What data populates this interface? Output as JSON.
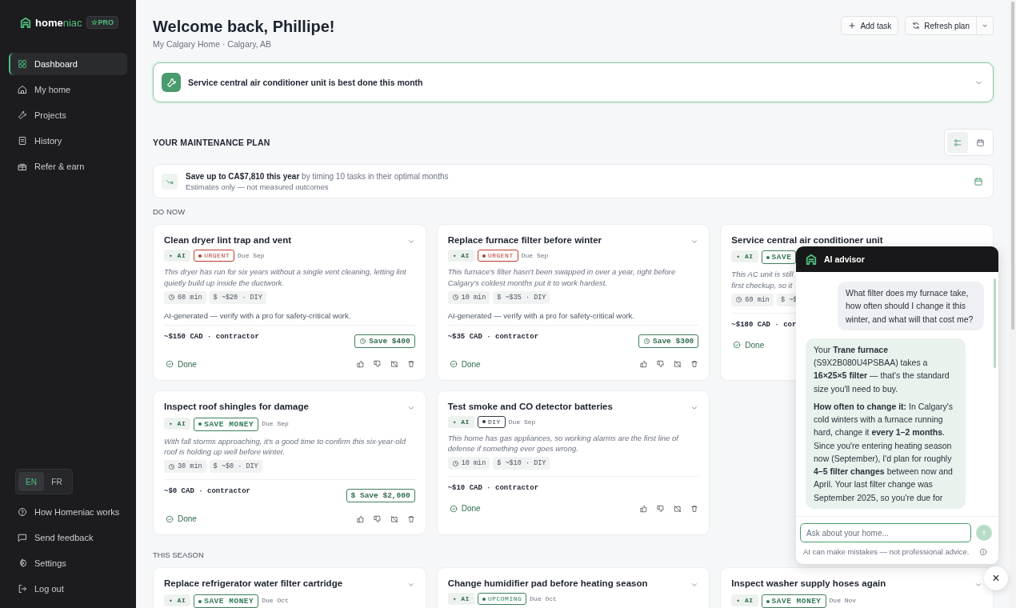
{
  "sidebar": {
    "logo": {
      "text_a": "home",
      "text_b": "niac"
    },
    "badge": "☆PRO",
    "nav": [
      {
        "label": "Dashboard",
        "selected": true
      },
      {
        "label": "My home",
        "selected": false
      },
      {
        "label": "Projects",
        "selected": false
      },
      {
        "label": "History",
        "selected": false
      },
      {
        "label": "Refer & earn",
        "selected": false
      }
    ],
    "languages": [
      {
        "label": "EN",
        "selected": true
      },
      {
        "label": "FR",
        "selected": false
      }
    ],
    "footer": [
      {
        "label": "How Homeniac works"
      },
      {
        "label": "Send feedback"
      },
      {
        "label": "Settings"
      },
      {
        "label": "Log out"
      }
    ]
  },
  "header": {
    "title": "Welcome back, Phillipe!",
    "subtitle": "My Calgary Home · Calgary, AB",
    "add_button": "Add task",
    "refresh_button": "Refresh plan"
  },
  "banner": {
    "text": "Service central air conditioner unit is best done this month"
  },
  "plan": {
    "title": "YOUR MAINTENANCE PLAN",
    "views": [
      {
        "selected": true
      },
      {
        "selected": false
      }
    ],
    "savings": {
      "text": "**Save up to CA$7,810 this year** by timing 10 tasks in their optimal months",
      "subtitle": "Estimates only — not measured outcomes"
    }
  },
  "sections": [
    {
      "title": "DO NOW",
      "cards": [
        {
          "title": "Clean dryer lint trap and vent",
          "tags": [
            {
              "label": "✦ AI",
              "kind": "ai"
            },
            {
              "label": "URGENT",
              "kind": "urgent"
            }
          ],
          "due": "Due Sep",
          "description": "This dryer has run for six years without a single vent cleaning, letting lint quietly build up inside the ductwork.",
          "time": "60 min",
          "cost": "$ ~$20 · DIY",
          "note": "AI-generated — verify with a pro for safety-critical work.",
          "price": "~$150 CAD · contractor",
          "savings": {
            "label": "Save $400",
            "kind": "clock"
          },
          "done": "Done",
          "actions": true
        },
        {
          "title": "Replace furnace filter before winter",
          "tags": [
            {
              "label": "✦ AI",
              "kind": "ai"
            },
            {
              "label": "URGENT",
              "kind": "urgent"
            }
          ],
          "due": "Due Sep",
          "description": "This furnace's filter hasn't been swapped in over a year, right before Calgary's coldest months put it to work hardest.",
          "time": "10 min",
          "cost": "$ ~$35 · DIY",
          "note": "AI-generated — verify with a pro for safety-critical work.",
          "price": "~$35 CAD · contractor",
          "savings": {
            "label": "Save $300",
            "kind": "clock"
          },
          "done": "Done",
          "actions": true
        },
        {
          "title": "Service central air conditioner unit",
          "tags": [
            {
              "label": "✦ AI",
              "kind": "ai"
            },
            {
              "label": "SAVE",
              "kind": "save"
            }
          ],
          "description": "This AC unit is still\nfirst checkup, so it",
          "time": "60 min",
          "cost": "$ ~$",
          "price": "~$180 CAD · cor",
          "done": "Done",
          "actions": false
        },
        {
          "title": "Inspect roof shingles for damage",
          "tags": [
            {
              "label": "✦ AI",
              "kind": "ai"
            },
            {
              "label": "SAVE MONEY",
              "kind": "save"
            }
          ],
          "due": "Due Sep",
          "description": "With fall storms approaching, it's a good time to confirm this six-year-old roof is holding up well before winter.",
          "time": "30 min",
          "cost": "$ ~$0 · DIY",
          "price": "~$0 CAD · contractor",
          "savings": {
            "label": "$ Save $2,000"
          },
          "done": "Done",
          "actions": true
        },
        {
          "title": "Test smoke and CO detector batteries",
          "tags": [
            {
              "label": "✦ AI",
              "kind": "ai"
            },
            {
              "label": "DIY",
              "kind": "diy"
            }
          ],
          "due": "Due Sep",
          "description": "This home has gas appliances, so working alarms are the first line of defense if something ever goes wrong.",
          "time": "10 min",
          "cost": "$ ~$10 · DIY",
          "price": "~$10 CAD · contractor",
          "done": "Done",
          "actions": true
        }
      ]
    },
    {
      "title": "THIS SEASON",
      "cards": [
        {
          "title": "Replace refrigerator water filter cartridge",
          "tags": [
            {
              "label": "✦ AI",
              "kind": "ai"
            },
            {
              "label": "SAVE MONEY",
              "kind": "save"
            }
          ],
          "due": "Due Oct"
        },
        {
          "title": "Change humidifier pad before heating season",
          "tags": [
            {
              "label": "✦ AI",
              "kind": "ai"
            },
            {
              "label": "UPCOMING",
              "kind": "upcoming"
            }
          ],
          "due": "Due Oct"
        },
        {
          "title": "Inspect washer supply hoses again",
          "tags": [
            {
              "label": "✦ AI",
              "kind": "ai"
            },
            {
              "label": "SAVE MONEY",
              "kind": "save"
            }
          ],
          "due": "Due Nov"
        }
      ]
    }
  ],
  "advisor": {
    "title": "AI advisor",
    "messages": [
      {
        "kind": "user",
        "paragraphs": [
          "What filter does my furnace take, how often should I change it this winter, and what will that cost me?"
        ]
      },
      {
        "kind": "assistant",
        "paragraphs": [
          "Your **Trane furnace** (S9X2B080U4PSBAA) takes a **16×25×5 filter** — that's the standard size you'll need to buy.",
          "**How often to change it:** In Calgary's cold winters with a furnace running hard, change it **every 1–2 months**. Since you're entering heating season now (September), I'd plan for roughly **4–5 filter changes** between now and April. Your last filter change was September 2025, so you're due for"
        ]
      }
    ],
    "input": {
      "placeholder": "Ask about your home..."
    },
    "disclaimer": "AI can make mistakes — not professional advice.",
    "close": "×"
  }
}
